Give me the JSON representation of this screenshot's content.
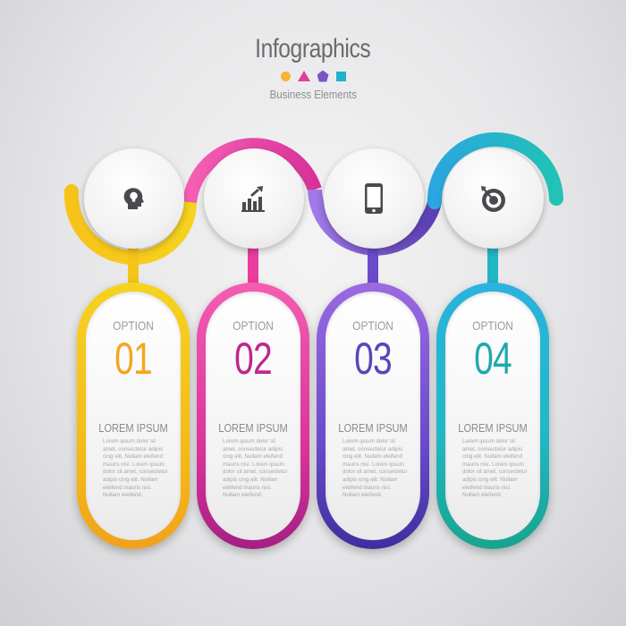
{
  "header": {
    "title": "Infographics",
    "subtitle": "Business Elements",
    "shape_colors": [
      "#f5b731",
      "#e0409a",
      "#7a55c6",
      "#24b0c9"
    ]
  },
  "options": [
    {
      "label": "OPTION",
      "number": "01",
      "heading": "LOREM IPSUM",
      "icon": "head-bulb-icon",
      "color": "#f5c518",
      "color_dark": "#f0a21c",
      "body": "Lorem ipsum dolor sit amet, consectetur adipis cing elit. Nullam eleifend mauris nisi. Lorem ipsum dolor sit amet, consectetur adipis cing elit. Nullam eleifend mauris nisi. Nullam eleifend."
    },
    {
      "label": "OPTION",
      "number": "02",
      "heading": "LOREM IPSUM",
      "icon": "growth-chart-icon",
      "color": "#f24ca6",
      "color_dark": "#b8238a",
      "body": "Lorem ipsum dolor sit amet, consectetur adipis cing elit. Nullam eleifend mauris nisi. Lorem ipsum dolor sit amet, consectetur adipis cing elit. Nullam eleifend mauris nisi. Nullam eleifend."
    },
    {
      "label": "OPTION",
      "number": "03",
      "heading": "LOREM IPSUM",
      "icon": "smartphone-icon",
      "color": "#8c5ce0",
      "color_dark": "#4f3cab",
      "body": "Lorem ipsum dolor sit amet, consectetur adipis cing elit. Nullam eleifend mauris nisi. Lorem ipsum dolor sit amet, consectetur adipis cing elit. Nullam eleifend mauris nisi. Nullam eleifend."
    },
    {
      "label": "OPTION",
      "number": "04",
      "heading": "LOREM IPSUM",
      "icon": "target-icon",
      "color": "#26bfd2",
      "color_dark": "#1aa39a",
      "body": "Lorem ipsum dolor sit amet, consectetur adipis cing elit. Nullam eleifend mauris nisi. Lorem ipsum dolor sit amet, consectetur adipis cing elit. Nullam eleifend mauris nisi. Nullam eleifend."
    }
  ]
}
